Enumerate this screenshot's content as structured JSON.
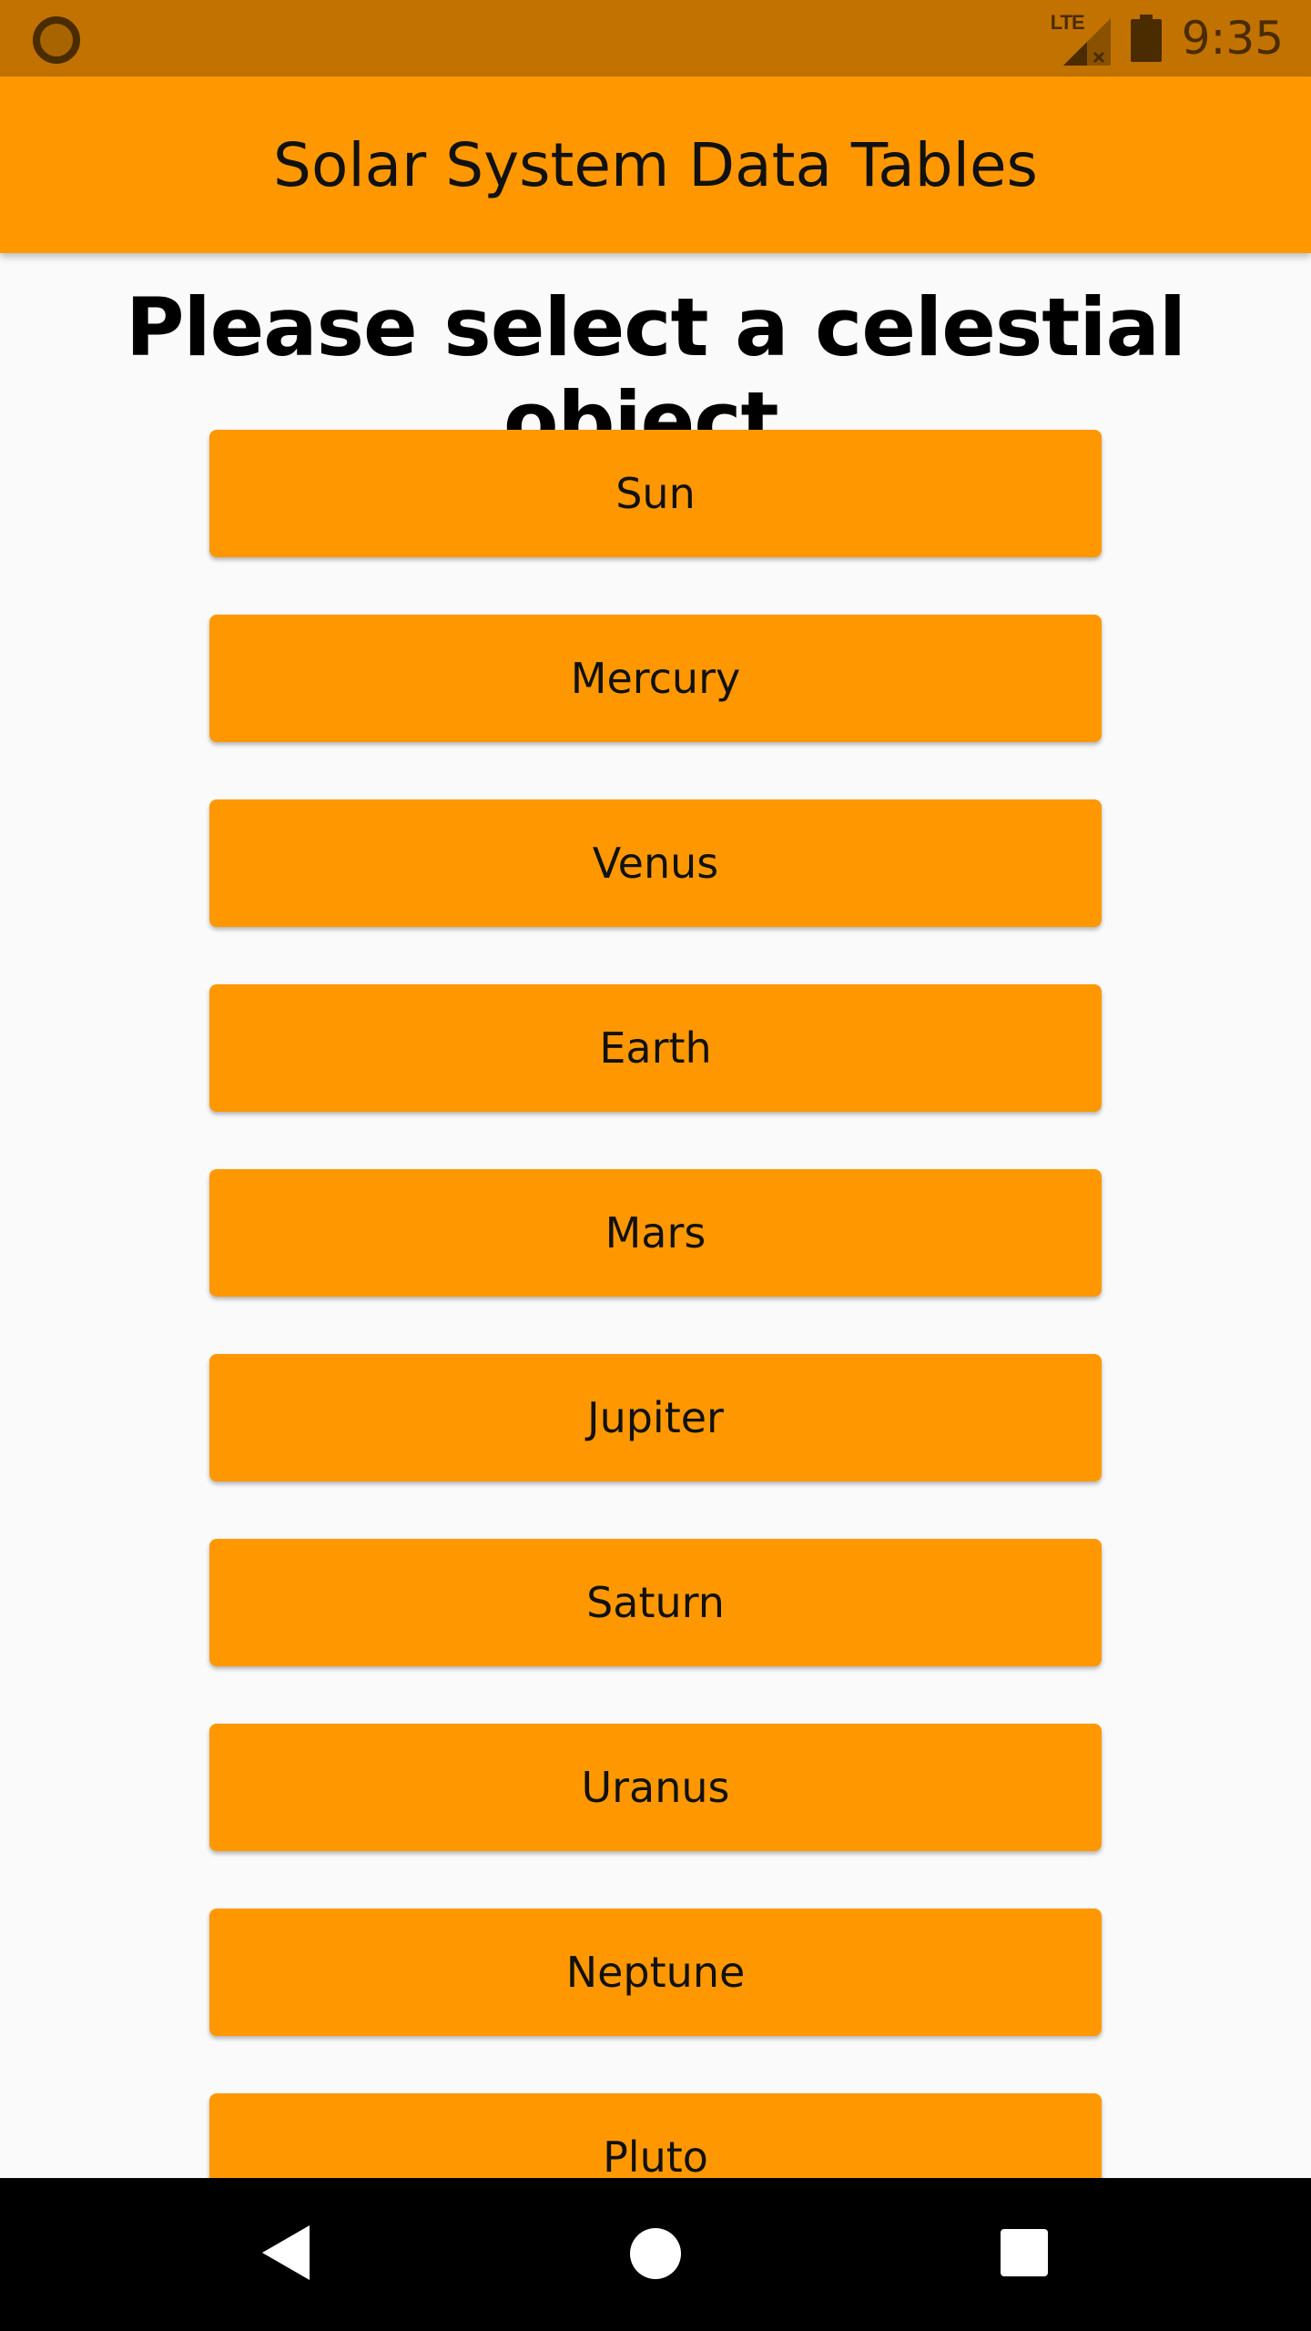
{
  "status_bar": {
    "time": "9:35",
    "network_label": "LTE",
    "icons": [
      "notification-circle-icon",
      "lte-signal-icon",
      "battery-icon"
    ]
  },
  "app_bar": {
    "title": "Solar System Data Tables"
  },
  "main": {
    "heading": "Please select a celestial object.",
    "objects": [
      {
        "label": "Sun"
      },
      {
        "label": "Mercury"
      },
      {
        "label": "Venus"
      },
      {
        "label": "Earth"
      },
      {
        "label": "Mars"
      },
      {
        "label": "Jupiter"
      },
      {
        "label": "Saturn"
      },
      {
        "label": "Uranus"
      },
      {
        "label": "Neptune"
      },
      {
        "label": "Pluto"
      }
    ]
  },
  "nav_bar": {
    "icons": [
      "back-icon",
      "home-icon",
      "recents-icon"
    ]
  },
  "colors": {
    "status_bar": "#c17200",
    "accent": "#ff9800",
    "background": "#fafafa",
    "nav_bar": "#000000"
  }
}
